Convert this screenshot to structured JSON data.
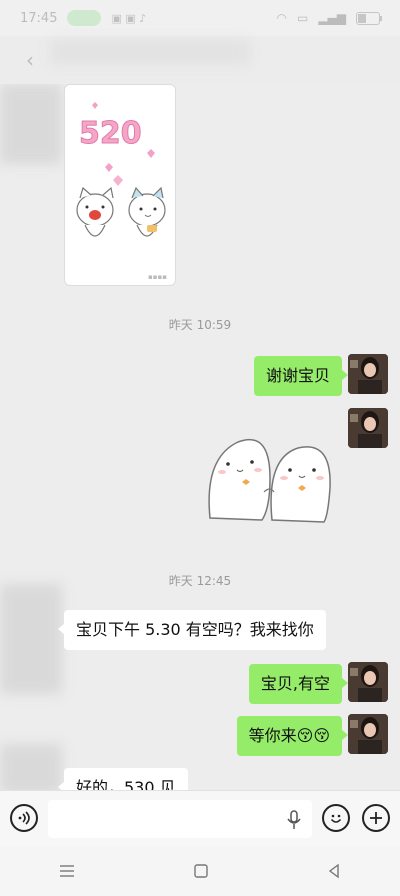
{
  "status_bar": {
    "time": "17:45"
  },
  "messages": {
    "time_1": "昨天 10:59",
    "msg_1": "谢谢宝贝",
    "time_2": "昨天 12:45",
    "msg_2": "宝贝下午 5.30 有空吗？我来找你",
    "msg_3": "宝贝,有空",
    "msg_4": "等你来",
    "msg_4_emoji": "😚😚",
    "msg_5": "好的，530 见"
  },
  "stickers": {
    "sticker_1_text": "520"
  },
  "colors": {
    "sent_bubble": "#95ec69",
    "received_bubble": "#ffffff",
    "background": "#ededed"
  }
}
